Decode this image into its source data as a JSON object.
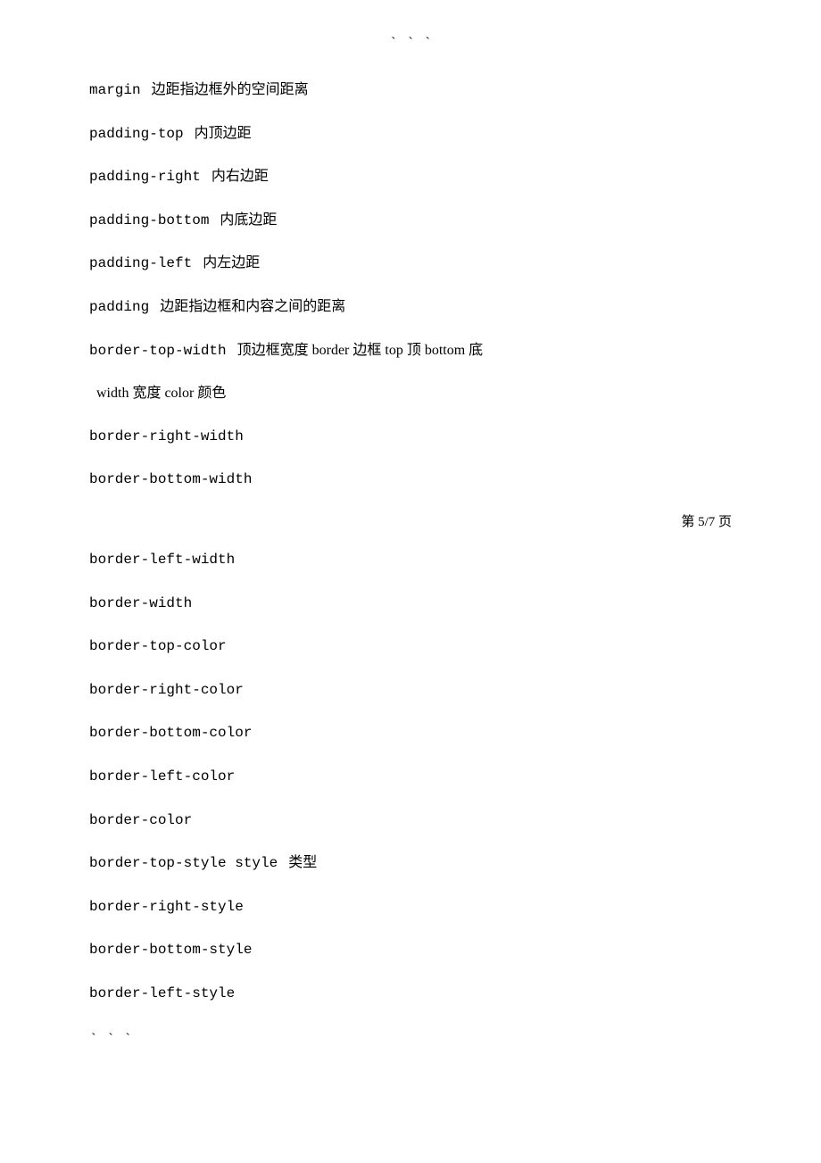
{
  "page": {
    "top_symbol": "` ` `",
    "bottom_symbol": "` ` `",
    "page_indicator": "第 5/7  页",
    "items": [
      {
        "term": "margin",
        "description": "  边距指边框外的空间距离"
      },
      {
        "term": "padding-top",
        "description": "    内顶边距"
      },
      {
        "term": "padding-right",
        "description": "    内右边距"
      },
      {
        "term": "padding-bottom",
        "description": "    内底边距"
      },
      {
        "term": "padding-left",
        "description": "    内左边距"
      },
      {
        "term": "padding",
        "description": "  边距指边框和内容之间的距离"
      },
      {
        "term": "border-top-width",
        "description": "    顶边框宽度  border  边框 top  顶 bottom  底 width  宽度 color   颜色"
      },
      {
        "term": "border-right-width",
        "description": ""
      },
      {
        "term": "border-bottom-width",
        "description": ""
      }
    ],
    "items2": [
      {
        "term": "border-left-width",
        "description": ""
      },
      {
        "term": "border-width",
        "description": ""
      },
      {
        "term": "border-top-color",
        "description": ""
      },
      {
        "term": "border-right-color",
        "description": ""
      },
      {
        "term": "border-bottom-color",
        "description": ""
      },
      {
        "term": "border-left-color",
        "description": ""
      },
      {
        "term": "border-color",
        "description": ""
      },
      {
        "term": "border-top-style style",
        "description": "        类型"
      },
      {
        "term": "border-right-style",
        "description": ""
      },
      {
        "term": "border-bottom-style",
        "description": ""
      },
      {
        "term": "border-left-style",
        "description": ""
      }
    ]
  }
}
